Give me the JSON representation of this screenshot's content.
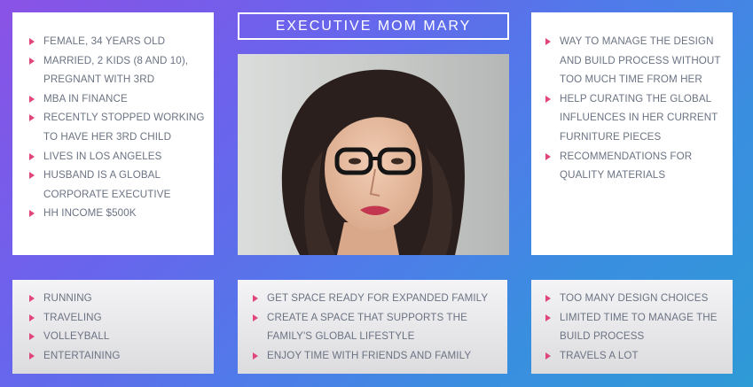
{
  "title": "EXECUTIVE MOM MARY",
  "demographics": {
    "items": [
      "FEMALE, 34 YEARS OLD",
      "MARRIED, 2 KIDS (8 AND 10), PREGNANT WITH 3RD",
      "MBA IN FINANCE",
      "RECENTLY STOPPED WORKING TO HAVE HER 3RD CHILD",
      "LIVES IN LOS ANGELES",
      "HUSBAND IS A GLOBAL CORPORATE EXECUTIVE",
      "HH INCOME $500K"
    ]
  },
  "needs": {
    "items": [
      "WAY TO MANAGE THE DESIGN AND BUILD PROCESS WITHOUT TOO MUCH TIME FROM HER",
      "HELP CURATING THE GLOBAL INFLUENCES IN HER CURRENT FURNITURE PIECES",
      "RECOMMENDATIONS FOR QUALITY MATERIALS"
    ]
  },
  "hobbies": {
    "items": [
      "RUNNING",
      "TRAVELING",
      "VOLLEYBALL",
      "ENTERTAINING"
    ]
  },
  "goals": {
    "items": [
      "GET SPACE READY FOR EXPANDED FAMILY",
      "CREATE A SPACE THAT SUPPORTS THE FAMILY'S GLOBAL LIFESTYLE",
      "ENJOY TIME WITH FRIENDS AND FAMILY"
    ]
  },
  "challenges": {
    "items": [
      "TOO MANY DESIGN CHOICES",
      "LIMITED TIME TO MANAGE THE BUILD PROCESS",
      "TRAVELS A LOT"
    ]
  },
  "colors": {
    "bullet": "#e0457b",
    "text": "#6b7383",
    "accent_start": "#8a52e6",
    "accent_end": "#2e9ad6"
  }
}
